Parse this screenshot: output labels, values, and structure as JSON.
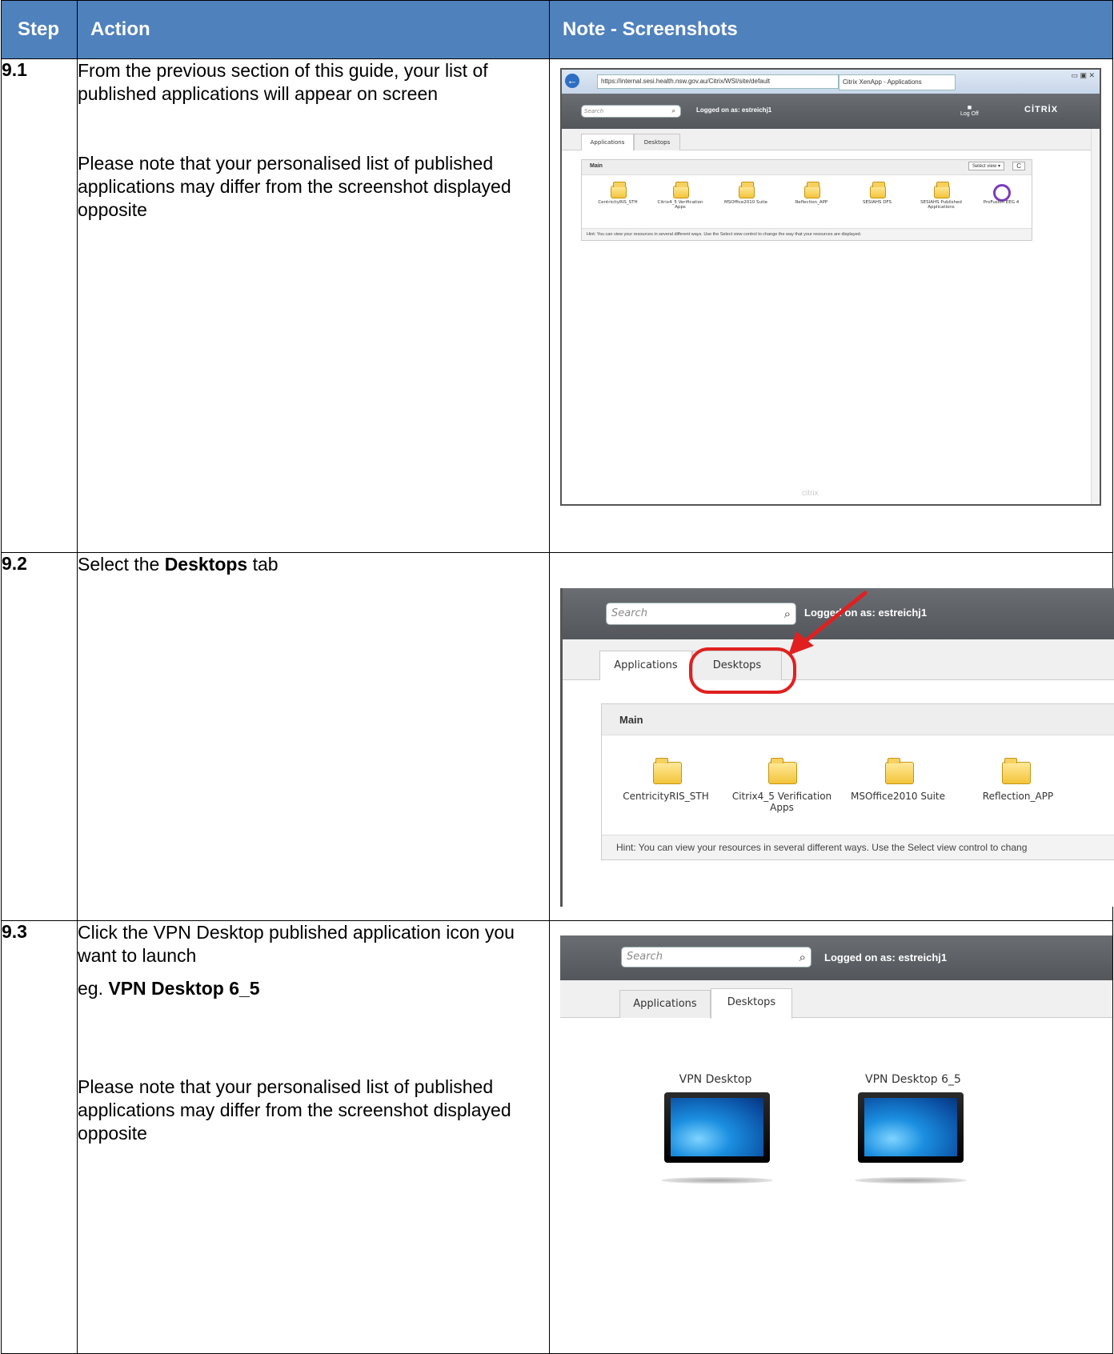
{
  "headers": {
    "step": "Step",
    "action": "Action",
    "notes": "Note - Screenshots"
  },
  "rows": [
    {
      "step": "9.1",
      "action_p1": "From the previous section of this guide, your list of published applications will appear on screen",
      "action_p2": "Please note that your personalised list of published applications may differ from the screenshot displayed opposite",
      "screenshot": {
        "url": "https://internal.sesi.health.nsw.gov.au/Citrix/WSI/site/default",
        "browser_tab": "Citrix XenApp - Applications",
        "search_placeholder": "Search",
        "logged_on": "Logged on as: estreichj1",
        "log_off": "Log Off",
        "brand": "CİTRİX",
        "tabs": [
          "Applications",
          "Desktops"
        ],
        "section": "Main",
        "select_view": "Select view",
        "apps": [
          "CentricityRIS_STH",
          "Citrix4_5 Verification Apps",
          "MSOffice2010 Suite",
          "Reflection_APP",
          "SESIAHS DFS",
          "SESIAHS Published Applications",
          "ProFusion EEG 4"
        ],
        "hint": "Hint: You can view your resources in several different ways. Use the Select view control to change the way that your resources are displayed.",
        "footer_brand": "citrix"
      }
    },
    {
      "step": "9.2",
      "action_pre": "Select the ",
      "action_bold": "Desktops",
      "action_post": " tab",
      "screenshot": {
        "search_placeholder": "Search",
        "logged_on": "Logged on as: estreichj1",
        "tabs": [
          "Applications",
          "Desktops"
        ],
        "section": "Main",
        "apps": [
          "CentricityRIS_STH",
          "Citrix4_5 Verification Apps",
          "MSOffice2010 Suite",
          "Reflection_APP"
        ],
        "hint": "Hint: You can view your resources in several different ways. Use the Select view control to chang"
      }
    },
    {
      "step": "9.3",
      "action_p1": "Click the VPN Desktop published application icon you want to launch",
      "action_eg_pre": "eg. ",
      "action_eg_bold": "VPN Desktop 6_5",
      "action_p3": "Please note that your personalised list of published applications may differ from the screenshot displayed opposite",
      "screenshot": {
        "search_placeholder": "Search",
        "logged_on": "Logged on as: estreichj1",
        "tabs": [
          "Applications",
          "Desktops"
        ],
        "desktops": [
          "VPN Desktop",
          "VPN Desktop 6_5"
        ]
      }
    }
  ],
  "colors": {
    "header_bg": "#4f81bd",
    "callout_red": "#e02020"
  }
}
